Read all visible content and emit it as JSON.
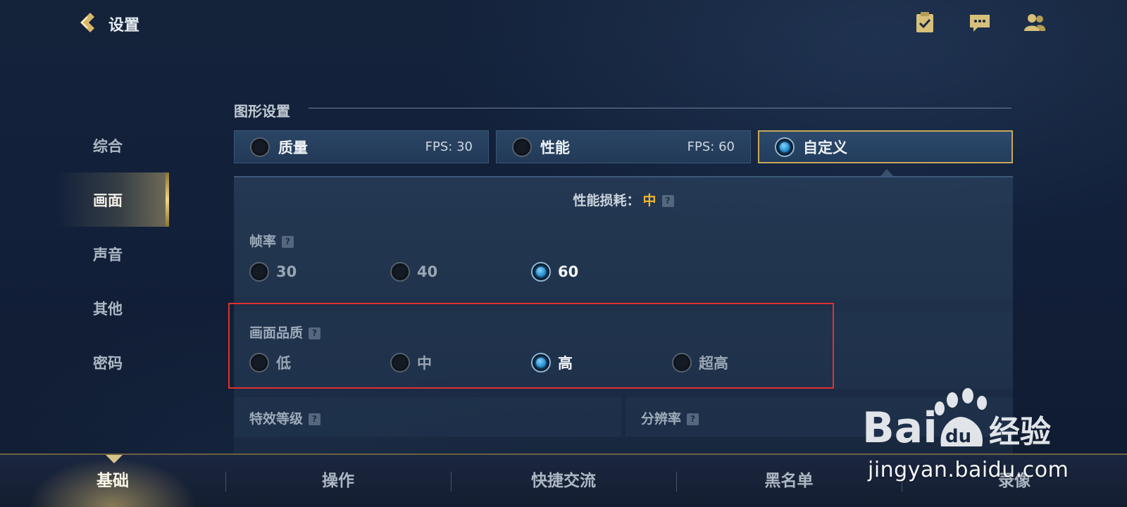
{
  "header": {
    "title": "设置"
  },
  "sidebar": {
    "items": [
      {
        "label": "综合"
      },
      {
        "label": "画面"
      },
      {
        "label": "声音"
      },
      {
        "label": "其他"
      },
      {
        "label": "密码"
      }
    ],
    "active_index": 1
  },
  "graphics": {
    "section_title": "图形设置",
    "presets": [
      {
        "label": "质量",
        "fps": "FPS: 30",
        "selected": false
      },
      {
        "label": "性能",
        "fps": "FPS: 60",
        "selected": false
      },
      {
        "label": "自定义",
        "fps": "",
        "selected": true
      }
    ],
    "perf_label": "性能损耗：",
    "perf_value": "中",
    "frame_rate": {
      "title": "帧率",
      "options": [
        "30",
        "40",
        "60"
      ],
      "selected": "60"
    },
    "quality": {
      "title": "画面品质",
      "options": [
        "低",
        "中",
        "高",
        "超高"
      ],
      "selected": "高"
    },
    "effects_title": "特效等级",
    "resolution_title": "分辨率",
    "help_mark": "?"
  },
  "bottom_tabs": [
    "基础",
    "操作",
    "快捷交流",
    "黑名单",
    "录像"
  ],
  "bottom_active": "基础",
  "watermark": {
    "brand": "Baidu经验",
    "url": "jingyan.baidu.com"
  },
  "colors": {
    "accent_gold": "#c8a85a",
    "perf_value": "#f2b62a",
    "highlight": "#e0312f",
    "radio_on": "#1d86c9"
  }
}
